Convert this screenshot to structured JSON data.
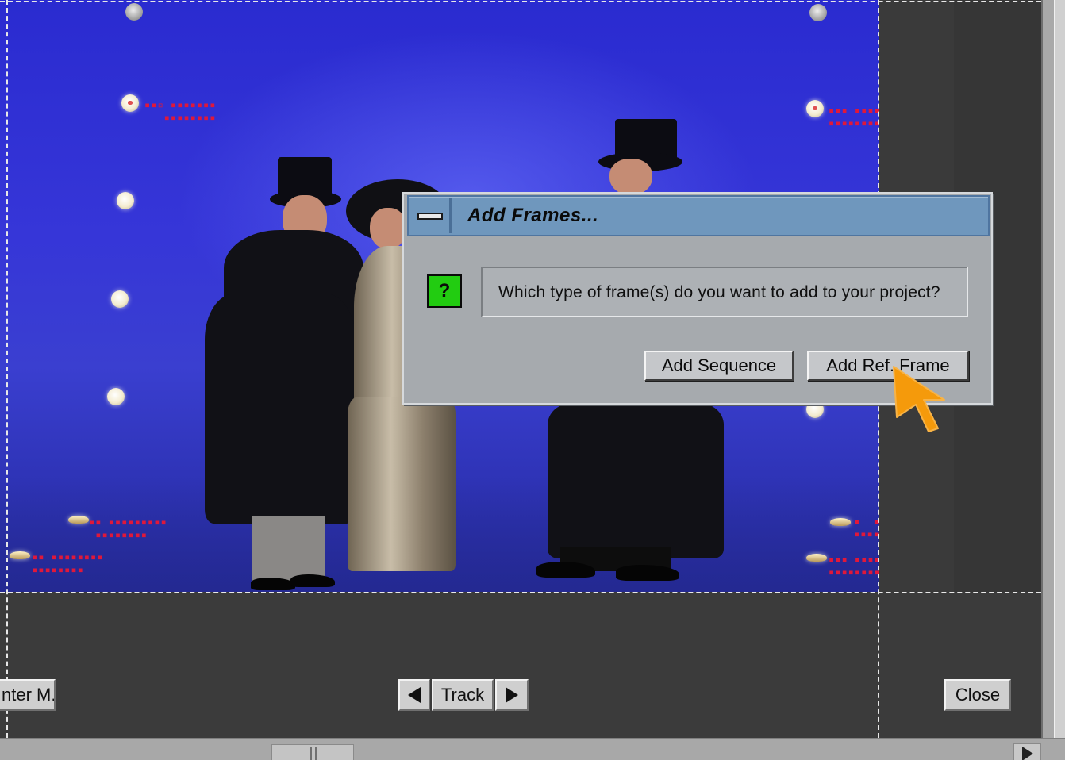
{
  "dialog": {
    "title": "Add Frames...",
    "icon": "question-icon",
    "icon_glyph": "?",
    "message": "Which type of frame(s) do you want to add to your project?",
    "buttons": {
      "add_sequence": "Add Sequence",
      "add_ref_frame": "Add Ref. Frame"
    }
  },
  "toolbar": {
    "left_button": "nter M.",
    "track_label": "Track",
    "close_label": "Close"
  },
  "colors": {
    "titlebar": "#6f97bd",
    "dialog_bg": "#a6aaae",
    "question_icon": "#22cc11",
    "cursor": "#f59a0b",
    "marker_label": "#e0183a"
  }
}
